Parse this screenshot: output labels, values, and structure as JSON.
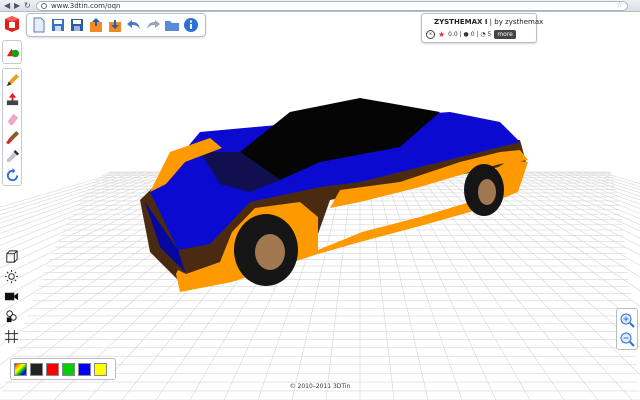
{
  "browser": {
    "url": "www.3dtin.com/oqn",
    "back_glyph": "◀",
    "forward_glyph": "▶",
    "reload_glyph": "↻",
    "star_glyph": "☆"
  },
  "toolbar": {
    "icons": [
      "new-file-icon",
      "save-icon",
      "save-as-icon",
      "export-icon",
      "import-icon",
      "undo-icon",
      "redo-icon",
      "open-folder-icon",
      "info-icon"
    ]
  },
  "info_panel": {
    "title": "ZYSTHEMAX I",
    "byline": "| by zysthemax",
    "comment_glyph": "∞",
    "rating_glyph": "★",
    "stats": "0.0 | ● 0 | ◔ 5",
    "more_label": "more"
  },
  "colors": {
    "swatches": [
      "#222222",
      "#ff0000",
      "#00d000",
      "#0000ff",
      "#ffff00"
    ],
    "accent_orange": "#ff9900",
    "accent_blue": "#0a0ad0"
  },
  "footer": {
    "text": "© 2010–2011 3DTin"
  }
}
